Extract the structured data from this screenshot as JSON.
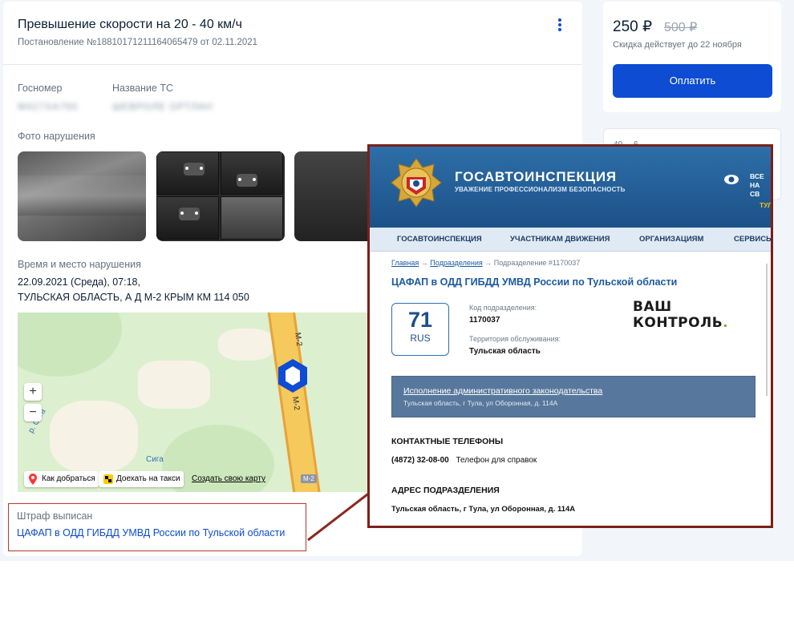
{
  "fine": {
    "title": "Превышение скорости на 20 - 40 км/ч",
    "subtitle": "Постановление №18810171211164065479 от 02.11.2021",
    "plate_label": "Госномер",
    "plate_value": "M427XA750",
    "vehicle_label": "Название ТС",
    "vehicle_value": "ШЕВРОЛЕ ОРТЛАН",
    "photos_label": "Фото нарушения",
    "time_place_label": "Время и место нарушения",
    "datetime": "22.09.2021 (Среда), 07:18,",
    "place": "ТУЛЬСКАЯ ОБЛАСТЬ, А Д М-2 КРЫМ КМ 114 050",
    "issuer_label": "Штраф выписан",
    "issuer": "ЦАФАП в ОДД ГИБДД УМВД России по Тульской области"
  },
  "map": {
    "road_label_top": "М-2",
    "road_label_mid": "М-2",
    "road_badge": "М-2",
    "river1": "р. Сига",
    "river2": "Сига",
    "zoom_in": "+",
    "zoom_out": "−",
    "route_btn": "Как добраться",
    "taxi_btn": "Доехать на такси",
    "create_map_link": "Создать свою карту"
  },
  "payment": {
    "price": "250 ₽",
    "old_price": "500 ₽",
    "discount_note": "Скидка действует до 22 ноября",
    "pay_button": "Оплатить",
    "second_card_text": "40 ... 6"
  },
  "gibdd": {
    "name": "ГОСАВТОИНСПЕКЦИЯ",
    "slogan": "УВАЖЕНИЕ ПРОФЕССИОНАЛИЗМ БЕЗОПАСНОСТЬ",
    "side_line1": "ВСЕ",
    "side_line2": "НА СВ",
    "side_line3": "ТУЛ",
    "nav": [
      "ГОСАВТОИНСПЕКЦИЯ",
      "УЧАСТНИКАМ ДВИЖЕНИЯ",
      "ОРГАНИЗАЦИЯМ",
      "СЕРВИСЫ"
    ],
    "crumb_home": "Главная",
    "crumb_sections": "Подразделения",
    "crumb_current": "Подразделение #1170037",
    "crumb_arrow": "→",
    "title": "ЦАФАП в ОДД ГИБДД УМВД России по Тульской области",
    "region_code": "71",
    "region_rus": "RUS",
    "code_label": "Код подразделения:",
    "code_value": "1170037",
    "territory_label": "Территория обслуживания:",
    "territory_value": "Тульская область",
    "logo_part1": "ВАШ",
    "logo_part2": "КОНТРОЛЬ",
    "logo_part3": ".",
    "bar_link": "Исполнение административного законодательства",
    "bar_address": "Тульская область, г Тула, ул Оборонная, д. 114А",
    "phones_heading": "КОНТАКТНЫЕ ТЕЛЕФОНЫ",
    "phone_number": "(4872) 32-08-00",
    "phone_desc": "Телефон для справок",
    "address_heading": "АДРЕС ПОДРАЗДЕЛЕНИЯ",
    "address_value": "Тульская область, г Тула, ул Оборонная, д. 114А"
  },
  "colors": {
    "accent": "#0d4cd3",
    "gibdd_blue": "#1c5188",
    "highlight_border": "#b13a2a"
  }
}
